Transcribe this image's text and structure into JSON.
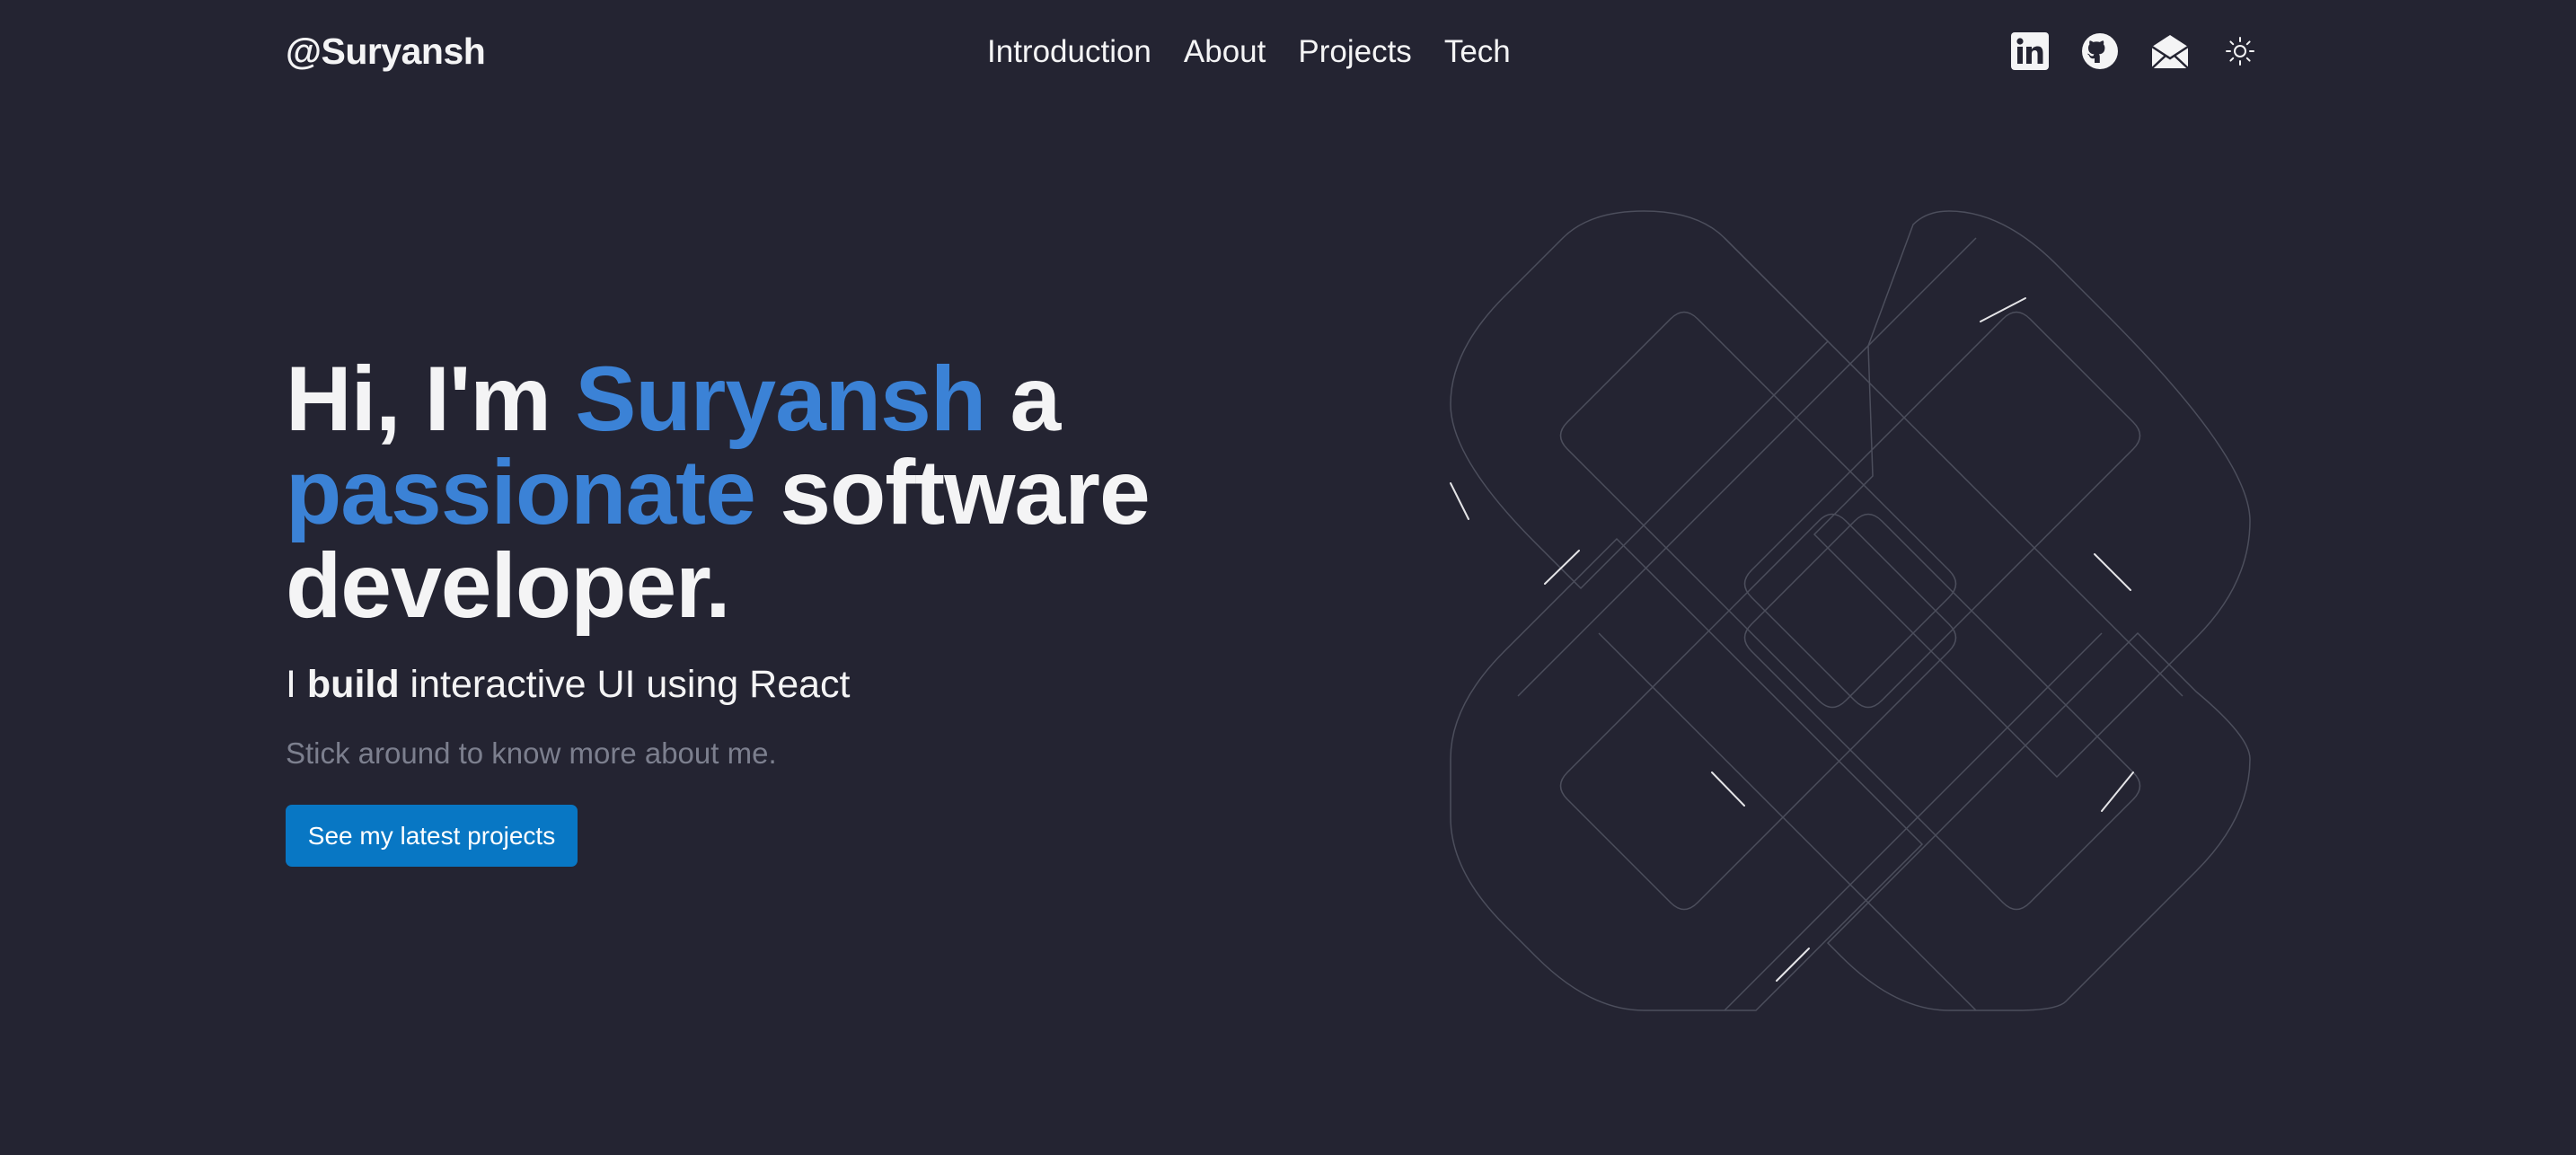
{
  "header": {
    "logo": "@Suryansh",
    "nav": [
      {
        "label": "Introduction"
      },
      {
        "label": "About"
      },
      {
        "label": "Projects"
      },
      {
        "label": "Tech"
      }
    ],
    "icons": [
      "linkedin-icon",
      "github-icon",
      "mail-icon",
      "sun-icon"
    ]
  },
  "hero": {
    "title_part1": "Hi, I'm ",
    "title_accent1": "Suryansh",
    "title_part2": " a ",
    "title_accent2": "passionate",
    "title_part3": " software developer.",
    "sub_part1": "I ",
    "sub_bold": "build",
    "sub_part2": " interactive UI using React",
    "note": "Stick around to know more about me.",
    "cta_label": "See my latest projects"
  },
  "colors": {
    "background": "#242432",
    "accent": "#3b82d6",
    "button": "#0877c4",
    "muted": "#7c7f8e"
  }
}
